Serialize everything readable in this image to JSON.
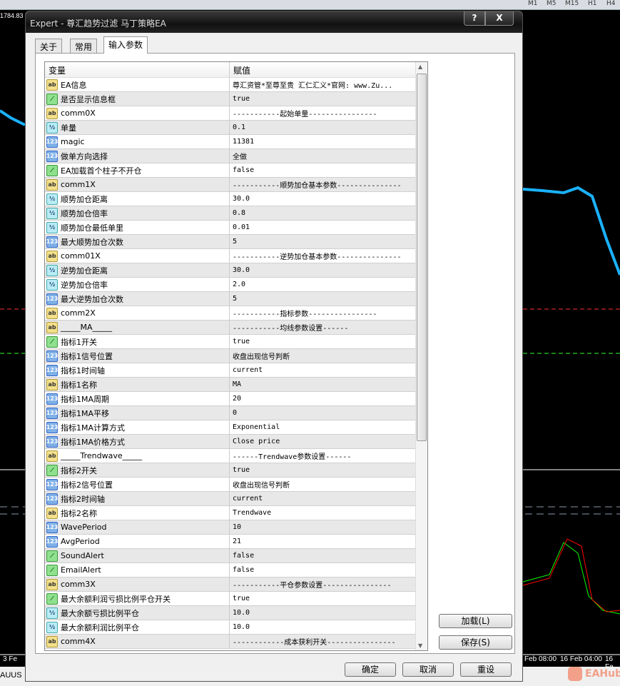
{
  "chart": {
    "price_label": "1784.83",
    "timeframes": [
      "M1",
      "M5",
      "M15",
      "H1",
      "H4"
    ],
    "axis_labels": [
      "3 Fe",
      "Feb 08:00",
      "16 Feb 04:00",
      "16 Fe"
    ],
    "symbol_tab": "AUUS",
    "watermark": "EAHub",
    "colors": {
      "ma": "#1ab2ff",
      "bull": "#00ff00",
      "bear": "#ffffff",
      "level_red": "#ff3030",
      "level_green": "#30ff30"
    }
  },
  "dialog": {
    "title": "Expert - 尊汇趋势过滤 马丁策略EA",
    "help": "?",
    "close": "X",
    "tabs": [
      {
        "label": "关于"
      },
      {
        "label": "常用"
      },
      {
        "label": "输入参数",
        "active": true
      }
    ],
    "columns": [
      "变量",
      "赋值"
    ],
    "rows": [
      {
        "type": "string",
        "icon": "ab",
        "name": "EA信息",
        "value": "尊汇资管*至尊至贵 汇仁汇义*官网: www.Zu..."
      },
      {
        "type": "bool",
        "icon": "bool",
        "name": "是否显示信息框",
        "value": "true"
      },
      {
        "type": "string",
        "icon": "ab",
        "name": "comm0X",
        "value": "-----------起始单量----------------"
      },
      {
        "type": "double",
        "icon": "½",
        "name": "单量",
        "value": "0.1"
      },
      {
        "type": "int",
        "icon": "123",
        "name": "magic",
        "value": "11381"
      },
      {
        "type": "int",
        "icon": "123",
        "name": "做单方向选择",
        "value": "全做"
      },
      {
        "type": "bool",
        "icon": "bool",
        "name": "EA加载首个柱子不开仓",
        "value": "false"
      },
      {
        "type": "string",
        "icon": "ab",
        "name": "comm1X",
        "value": "-----------顺势加仓基本参数---------------"
      },
      {
        "type": "double",
        "icon": "½",
        "name": "顺势加仓距离",
        "value": "30.0"
      },
      {
        "type": "double",
        "icon": "½",
        "name": "顺势加仓倍率",
        "value": "0.8"
      },
      {
        "type": "double",
        "icon": "½",
        "name": "顺势加仓最低单里",
        "value": "0.01"
      },
      {
        "type": "int",
        "icon": "123",
        "name": "最大顺势加仓次数",
        "value": "5"
      },
      {
        "type": "string",
        "icon": "ab",
        "name": "comm01X",
        "value": "-----------逆势加仓基本参数---------------"
      },
      {
        "type": "double",
        "icon": "½",
        "name": "逆势加仓距离",
        "value": "30.0"
      },
      {
        "type": "double",
        "icon": "½",
        "name": "逆势加仓倍率",
        "value": "2.0"
      },
      {
        "type": "int",
        "icon": "123",
        "name": "最大逆势加仓次数",
        "value": "5"
      },
      {
        "type": "string",
        "icon": "ab",
        "name": "comm2X",
        "value": "-----------指标参数----------------"
      },
      {
        "type": "string",
        "icon": "ab",
        "name": "_____MA_____",
        "value": "-----------均线参数设置------"
      },
      {
        "type": "bool",
        "icon": "bool",
        "name": "指标1开关",
        "value": "true"
      },
      {
        "type": "int",
        "icon": "123",
        "name": "指标1信号位置",
        "value": "收盘出现信号判断"
      },
      {
        "type": "int",
        "icon": "123",
        "name": "指标1时间轴",
        "value": "current"
      },
      {
        "type": "string",
        "icon": "ab",
        "name": "指标1名称",
        "value": "MA"
      },
      {
        "type": "int",
        "icon": "123",
        "name": "指标1MA周期",
        "value": "20"
      },
      {
        "type": "int",
        "icon": "123",
        "name": "指标1MA平移",
        "value": "0"
      },
      {
        "type": "int",
        "icon": "123",
        "name": "指标1MA计算方式",
        "value": "Exponential"
      },
      {
        "type": "int",
        "icon": "123",
        "name": "指标1MA价格方式",
        "value": "Close price"
      },
      {
        "type": "string",
        "icon": "ab",
        "name": "_____Trendwave_____",
        "value": "------Trendwave参数设置------"
      },
      {
        "type": "bool",
        "icon": "bool",
        "name": "指标2开关",
        "value": "true"
      },
      {
        "type": "int",
        "icon": "123",
        "name": "指标2信号位置",
        "value": "收盘出现信号判断"
      },
      {
        "type": "int",
        "icon": "123",
        "name": "指标2时间轴",
        "value": "current"
      },
      {
        "type": "string",
        "icon": "ab",
        "name": "指标2名称",
        "value": "Trendwave"
      },
      {
        "type": "int",
        "icon": "123",
        "name": "WavePeriod",
        "value": "10"
      },
      {
        "type": "int",
        "icon": "123",
        "name": "AvgPeriod",
        "value": "21"
      },
      {
        "type": "bool",
        "icon": "bool",
        "name": "SoundAlert",
        "value": "false"
      },
      {
        "type": "bool",
        "icon": "bool",
        "name": "EmailAlert",
        "value": "false"
      },
      {
        "type": "string",
        "icon": "ab",
        "name": "comm3X",
        "value": "-----------平仓参数设置----------------"
      },
      {
        "type": "bool",
        "icon": "bool",
        "name": "最大余额利润亏损比例平仓开关",
        "value": "true"
      },
      {
        "type": "double",
        "icon": "½",
        "name": "最大余额亏损比例平仓",
        "value": "10.0"
      },
      {
        "type": "double",
        "icon": "½",
        "name": "最大余额利润比例平仓",
        "value": "10.0"
      },
      {
        "type": "string",
        "icon": "ab",
        "name": "comm4X",
        "value": "------------成本获利开关----------------"
      }
    ],
    "load_button": "加载(L)",
    "save_button": "保存(S)",
    "ok_button": "确定",
    "cancel_button": "取消",
    "reset_button": "重设"
  }
}
